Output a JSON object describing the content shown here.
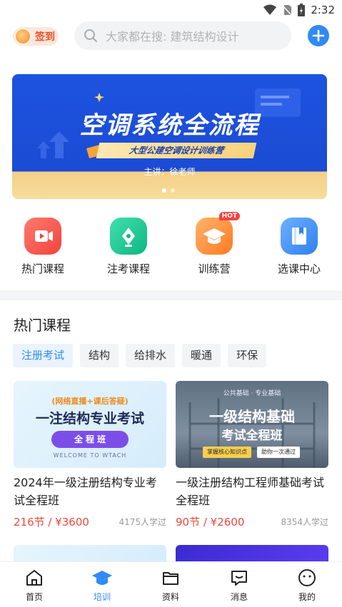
{
  "status_bar": {
    "time": "2:32"
  },
  "header": {
    "signin_label": "签到",
    "search_placeholder": "大家都在搜: 建筑结构设计"
  },
  "banner": {
    "title": "空调系统全流程",
    "subtitle": "大型公建空调设计训练营",
    "teacher": "主讲：徐老师",
    "slide_count": 2,
    "active_slide": 1
  },
  "quick_nav": [
    {
      "label": "热门课程",
      "icon": "video-icon",
      "color": "#f2524b"
    },
    {
      "label": "注考课程",
      "icon": "pen-nib-icon",
      "color": "#14c38e"
    },
    {
      "label": "训练营",
      "icon": "graduation-cap-icon",
      "color": "#ff8a2a",
      "badge": "HOT"
    },
    {
      "label": "选课中心",
      "icon": "book-icon",
      "color": "#3d8ef6"
    }
  ],
  "hot_courses": {
    "title": "热门课程",
    "categories": [
      "注册考试",
      "结构",
      "给排水",
      "暖通",
      "环保"
    ],
    "active_category": 0,
    "courses": [
      {
        "title": "2024年一级注册结构专业考试全程班",
        "price": "216节 / ¥3600",
        "learners": "4175人学过",
        "thumb": {
          "line1": "(网络直播+课后答疑)",
          "line2": "一注结构专业考试",
          "pill": "全 程 班",
          "foot": "WELCOME TO WTACH"
        }
      },
      {
        "title": "一级注册结构工程师基础考试全程班",
        "price": "90节 / ¥2600",
        "learners": "8354人学过",
        "thumb": {
          "top": "公共基础 · 专业基础",
          "line1": "一级结构基础",
          "line2": "考试全程班",
          "tag1": "掌握核心知识点",
          "tag2": "助你一次通过"
        }
      }
    ]
  },
  "tab_bar": {
    "active": 1,
    "tabs": [
      {
        "label": "首页",
        "icon": "home-icon"
      },
      {
        "label": "培训",
        "icon": "graduation-cap-icon"
      },
      {
        "label": "资料",
        "icon": "folder-icon"
      },
      {
        "label": "消息",
        "icon": "message-icon"
      },
      {
        "label": "我的",
        "icon": "profile-icon"
      }
    ]
  }
}
